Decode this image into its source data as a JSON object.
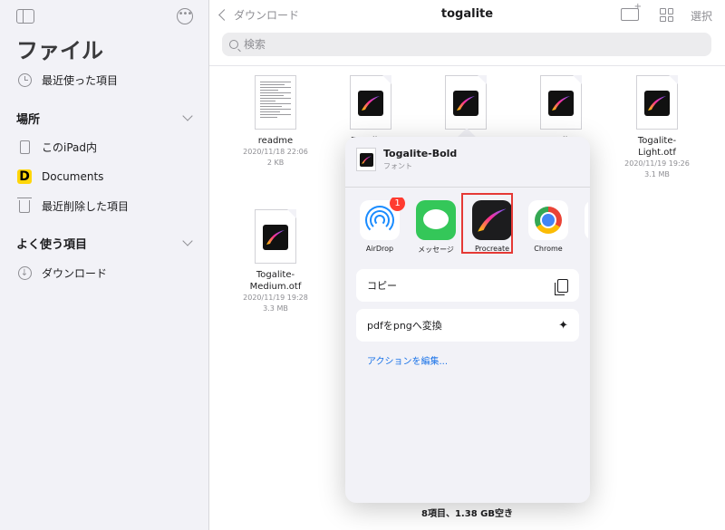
{
  "sidebar": {
    "title": "ファイル",
    "recents": "最近使った項目",
    "locations_header": "場所",
    "locations": [
      "このiPad内",
      "Documents",
      "最近削除した項目"
    ],
    "favorites_header": "よく使う項目",
    "favorites": [
      "ダウンロード"
    ]
  },
  "nav": {
    "back_label": "ダウンロード",
    "title": "togalite",
    "select_label": "選択"
  },
  "search": {
    "placeholder": "検索"
  },
  "files": [
    {
      "name": "readme",
      "date": "2020/11/18 22:06",
      "size": "2 KB"
    },
    {
      "name": "Togalite-",
      "date": "",
      "size": ""
    },
    {
      "name": "Togalite-Bold.otf",
      "date": "",
      "size": ""
    },
    {
      "name": "Togalite-",
      "date": "",
      "size": ""
    },
    {
      "name": "Togalite-Light.otf",
      "date": "2020/11/19 19:26",
      "size": "3.1 MB"
    },
    {
      "name": "Togalite-Medium.otf",
      "date": "2020/11/19 19:28",
      "size": "3.3 MB"
    }
  ],
  "file_name_lines": {
    "light": [
      "Togalite-",
      "Light.otf"
    ],
    "medium": [
      "Togalite-",
      "Medium.otf"
    ]
  },
  "status": "8項目、1.38 GB空き",
  "share_sheet": {
    "file_name": "Togalite-Bold",
    "file_kind": "フォント",
    "apps": [
      {
        "label": "AirDrop",
        "badge": "1"
      },
      {
        "label": "メッセージ"
      },
      {
        "label": "Procreate"
      },
      {
        "label": "Chrome"
      }
    ],
    "actions": [
      "コピー",
      "pdfをpngへ変換"
    ],
    "edit_actions": "アクションを編集..."
  },
  "colors": {
    "accent": "#1a73e8",
    "badge": "#ff3b30",
    "highlight": "#e53935"
  }
}
